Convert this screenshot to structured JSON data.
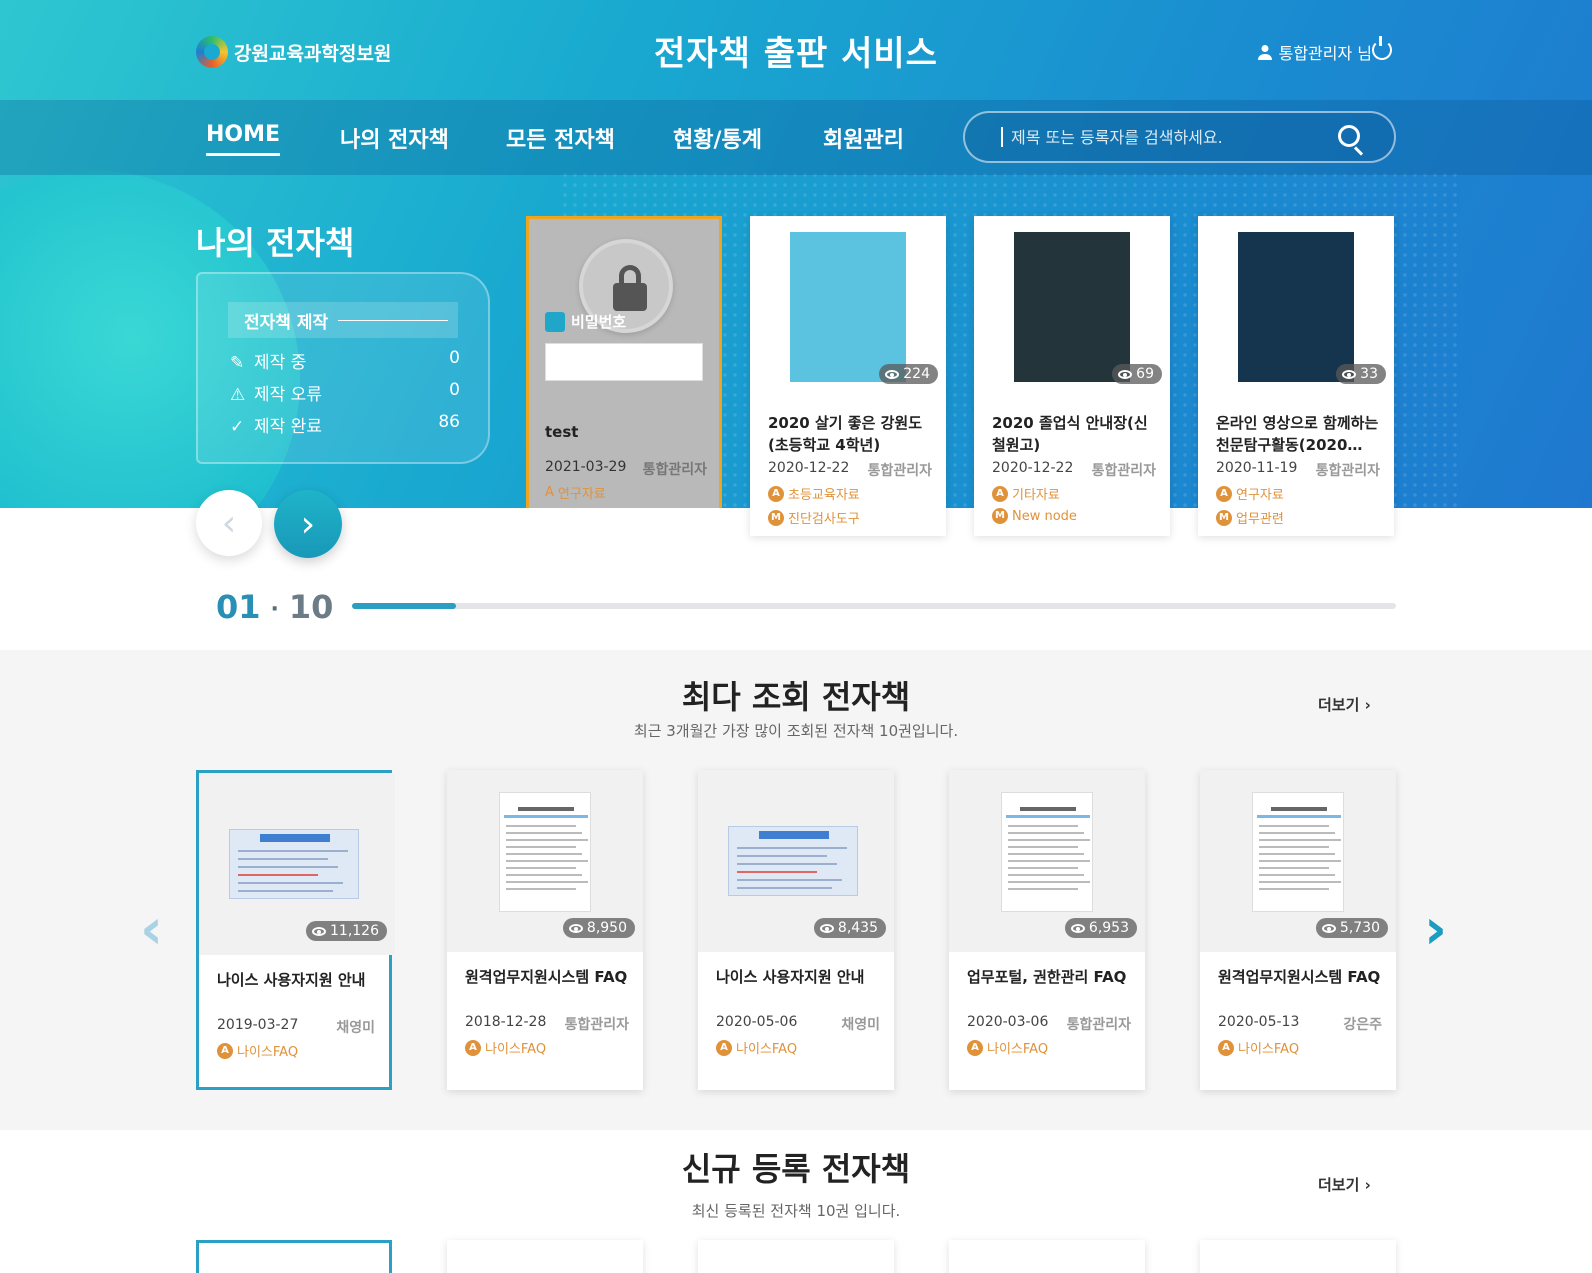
{
  "header": {
    "org_name": "강원교육과학정보원",
    "site_title": "전자책 출판 서비스",
    "user_label": "통합관리자 님"
  },
  "nav": {
    "items": [
      "HOME",
      "나의 전자책",
      "모든 전자책",
      "현황/통계",
      "회원관리"
    ],
    "active": "HOME",
    "search_placeholder": "제목 또는 등록자를 검색하세요."
  },
  "my_books": {
    "title": "나의 전자책",
    "panel_heading": "전자책 제작",
    "stats": [
      {
        "label": "제작 중",
        "value": "0",
        "icon": "edit-icon"
      },
      {
        "label": "제작 오류",
        "value": "0",
        "icon": "warning-icon"
      },
      {
        "label": "제작 완료",
        "value": "86",
        "icon": "check-icon"
      }
    ],
    "pager": {
      "current": "01",
      "separator": "·",
      "total": "10",
      "progress_fraction": 0.1
    },
    "locked_card": {
      "password_label": "비밀번호",
      "title": "test",
      "date": "2021-03-29",
      "author": "통합관리자",
      "tags": [
        {
          "badge": "A",
          "text": "연구자료"
        }
      ]
    },
    "cards": [
      {
        "title": "2020 살기 좋은 강원도(초등학교 4학년)",
        "views": "224",
        "date": "2020-12-22",
        "author": "통합관리자",
        "tags": [
          {
            "badge": "A",
            "text": "초등교육자료"
          },
          {
            "badge": "M",
            "text": "진단검사도구"
          }
        ],
        "cover": "#5bc3e0"
      },
      {
        "title": "2020 졸업식 안내장(신철원고)",
        "views": "69",
        "date": "2020-12-22",
        "author": "통합관리자",
        "tags": [
          {
            "badge": "A",
            "text": "기타자료"
          },
          {
            "badge": "M",
            "text": "New node"
          }
        ],
        "cover": "#23343b"
      },
      {
        "title": "온라인 영상으로 함께하는 천문탐구활동(2020…",
        "views": "33",
        "date": "2020-11-19",
        "author": "통합관리자",
        "tags": [
          {
            "badge": "A",
            "text": "연구자료"
          },
          {
            "badge": "M",
            "text": "업무관련"
          }
        ],
        "cover": "#14354d"
      }
    ]
  },
  "popular": {
    "title": "최다 조회 전자책",
    "subtitle": "최근 3개월간 가장 많이 조회된 전자책 10권입니다.",
    "more_label": "더보기",
    "cards": [
      {
        "title": "나이스 사용자지원 안내",
        "views": "11,126",
        "date": "2019-03-27",
        "author": "채영미",
        "tag": {
          "badge": "A",
          "text": "나이스FAQ"
        },
        "thumb": "doc"
      },
      {
        "title": "원격업무지원시스템 FAQ",
        "views": "8,950",
        "date": "2018-12-28",
        "author": "통합관리자",
        "tag": {
          "badge": "A",
          "text": "나이스FAQ"
        },
        "thumb": "faq"
      },
      {
        "title": "나이스 사용자지원 안내",
        "views": "8,435",
        "date": "2020-05-06",
        "author": "채영미",
        "tag": {
          "badge": "A",
          "text": "나이스FAQ"
        },
        "thumb": "doc"
      },
      {
        "title": "업무포털, 권한관리 FAQ",
        "views": "6,953",
        "date": "2020-03-06",
        "author": "통합관리자",
        "tag": {
          "badge": "A",
          "text": "나이스FAQ"
        },
        "thumb": "faq"
      },
      {
        "title": "원격업무지원시스템 FAQ",
        "views": "5,730",
        "date": "2020-05-13",
        "author": "강은주",
        "tag": {
          "badge": "A",
          "text": "나이스FAQ"
        },
        "thumb": "faq"
      }
    ]
  },
  "recent": {
    "title": "신규 등록 전자책",
    "subtitle": "최신 등록된 전자책 10권 입니다.",
    "more_label": "더보기"
  }
}
